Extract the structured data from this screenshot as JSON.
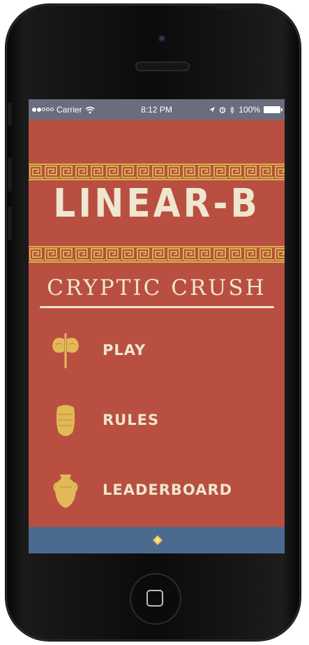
{
  "device": {
    "icons": [
      "camera-icon",
      "speaker-icon",
      "home-button-icon"
    ]
  },
  "statusbar": {
    "carrier": "Carrier",
    "time": "8:12 PM",
    "battery": "100%",
    "signal_dots_on": 2,
    "signal_dots_total": 5,
    "icons": [
      "wifi-icon",
      "location-icon",
      "alarm-icon",
      "bluetooth-icon",
      "battery-icon"
    ]
  },
  "app": {
    "title": "LINEAR-B",
    "subtitle": "CRYPTIC CRUSH",
    "menu": [
      {
        "label": "PLAY",
        "icon": "double-axe-icon"
      },
      {
        "label": "RULES",
        "icon": "shield-icon"
      },
      {
        "label": "LEADERBOARD",
        "icon": "amphora-icon"
      }
    ],
    "bottom_icon": "diamond-icon"
  },
  "colors": {
    "background": "#b84f40",
    "statusbar": "#6b6d7f",
    "accent_gold": "#d7b24c",
    "text_cream": "#efe6cf",
    "bottombar": "#4a6b8f"
  }
}
